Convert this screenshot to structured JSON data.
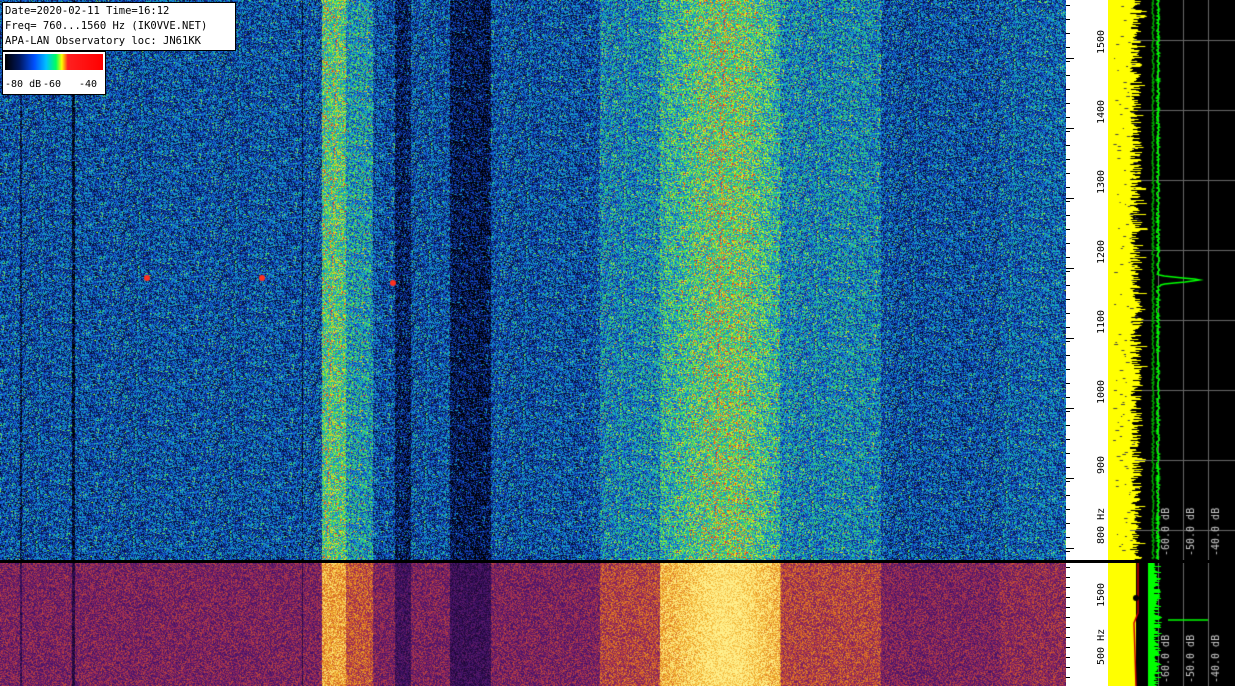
{
  "info": {
    "line1": "Date=2020-02-11 Time=16:12",
    "line2": "Freq= 760...1560 Hz (IK0VVE.NET)",
    "line3": "APA-LAN Observatory loc: JN61KK"
  },
  "color_scale": {
    "labels": [
      "-80 dB",
      "-60",
      "-40"
    ],
    "colors": [
      "#000000",
      "#0050ff",
      "#00c0ff",
      "#00ff60",
      "#ffff00",
      "#ff0000"
    ]
  },
  "freq_axis_top": {
    "labels": [
      "1500",
      "1400",
      "1300",
      "1200",
      "1100",
      "1000",
      "900",
      "800 Hz"
    ]
  },
  "freq_axis_bottom": {
    "labels": [
      "1500",
      "500 Hz"
    ]
  },
  "spectrum_top": {
    "db_labels": [
      "-60.0 dB",
      "-50.0 dB",
      "-40.0 dB"
    ]
  },
  "spectrum_bottom": {
    "db_labels": [
      "-60.0 dB",
      "-50.0 dB",
      "-40.0 dB"
    ]
  },
  "colors": {
    "waterfall_bg": "#0b2a7a",
    "bottom_bg": "#3a1a6a",
    "spectrum_yellow": "#ffff00",
    "spectrum_green": "#00ff00"
  }
}
